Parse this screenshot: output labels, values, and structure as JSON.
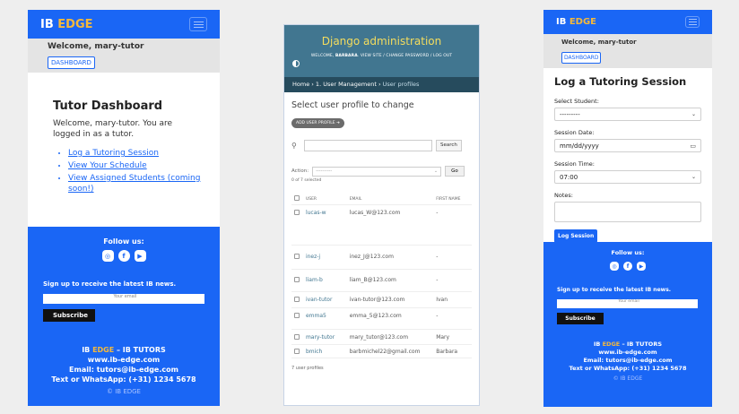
{
  "ib_phone_1": {
    "brand_main": "IB",
    "brand_accent": "EDGE",
    "welcome": "Welcome, mary-tutor",
    "dashboard_btn": "DASHBOARD",
    "title": "Tutor Dashboard",
    "intro": "Welcome, mary-tutor. You are logged in as a tutor.",
    "links": [
      "Log a Tutoring Session",
      "View Your Schedule",
      "View Assigned Students (coming soon!)"
    ]
  },
  "footer": {
    "follow": "Follow us:",
    "social_icons": [
      "instagram-icon",
      "facebook-icon",
      "youtube-icon"
    ],
    "signup": "Sign up to receive the latest IB news.",
    "email_placeholder": "Your email",
    "subscribe": "Subscribe",
    "contact_brand_main": "IB",
    "contact_brand_accent": "EDGE",
    "contact_brand_suffix": " – IB TUTORS",
    "website": "www.ib-edge.com",
    "email": "Email: tutors@ib-edge.com",
    "phone": "Text or WhatsApp: (+31) 1234 5678",
    "copyright": "© IB EDGE"
  },
  "django": {
    "site_title": "Django administration",
    "welcome_prefix": "WELCOME,",
    "user": "BARBARA",
    "tools": ". VIEW SITE / CHANGE PASSWORD / LOG OUT",
    "breadcrumbs": "Home › 1. User Management ›",
    "breadcrumb_current": "User profiles",
    "heading": "Select user profile to change",
    "add_button": "ADD USER PROFILE ➔",
    "search_button": "Search",
    "action_label": "Action:",
    "action_value": "----------",
    "go_button": "Go",
    "selected_count": "0 of 7 selected",
    "columns": [
      "USER",
      "EMAIL",
      "FIRST NAME"
    ],
    "rows": [
      {
        "user": "lucas-w",
        "email": "lucas_W@123.com",
        "first": "-"
      },
      {
        "user": "inez-j",
        "email": "inez_J@123.com",
        "first": "-"
      },
      {
        "user": "liam-b",
        "email": "liam_B@123.com",
        "first": "-"
      },
      {
        "user": "ivan-tutor",
        "email": "ivan-tutor@123.com",
        "first": "Ivan"
      },
      {
        "user": "emma5",
        "email": "emma_5@123.com",
        "first": "-"
      },
      {
        "user": "mary-tutor",
        "email": "mary_tutor@123.com",
        "first": "Mary"
      },
      {
        "user": "bmich",
        "email": "barbmichel22@gmail.com",
        "first": "Barbara"
      }
    ],
    "result_count": "7 user profiles"
  },
  "ib_phone_3": {
    "brand_main": "IB",
    "brand_accent": "EDGE",
    "welcome": "Welcome, mary-tutor",
    "dashboard_btn": "DASHBOARD",
    "title": "Log a Tutoring Session",
    "student_label": "Select Student:",
    "student_value": "---------",
    "date_label": "Session Date:",
    "date_value": "mm/dd/yyyy",
    "time_label": "Session Time:",
    "time_value": "07:00",
    "notes_label": "Notes:",
    "submit": "Log Session"
  },
  "colors": {
    "brand_blue": "#1a66f5",
    "brand_gold": "#f5b93b",
    "django_header": "#417690",
    "django_breadcrumbs": "#264b5d",
    "django_title": "#f5dd5d"
  }
}
